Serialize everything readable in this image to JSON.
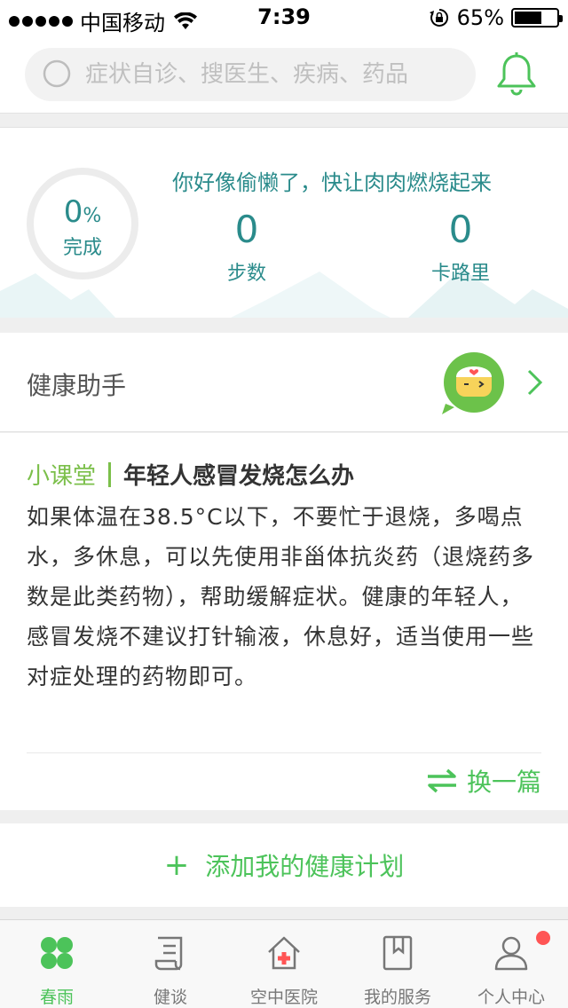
{
  "status_bar": {
    "carrier": "中国移动",
    "time": "7:39",
    "battery": "65%",
    "battery_level": 0.65
  },
  "search": {
    "placeholder": "症状自诊、搜医生、疾病、药品"
  },
  "steps_card": {
    "progress_value": "0",
    "progress_unit": "%",
    "progress_label": "完成",
    "message": "你好像偷懒了，快让肉肉燃烧起来",
    "steps_value": "0",
    "steps_label": "步数",
    "calories_value": "0",
    "calories_label": "卡路里"
  },
  "assistant": {
    "title": "健康助手"
  },
  "lesson": {
    "tag": "小课堂",
    "title": "年轻人感冒发烧怎么办",
    "body": "如果体温在38.5°C以下，不要忙于退烧，多喝点水，多休息，可以先使用非甾体抗炎药（退烧药多数是此类药物），帮助缓解症状。健康的年轻人，感冒发烧不建议打针输液，休息好，适当使用一些对症处理的药物即可。",
    "swap_label": "换一篇"
  },
  "add_plan": {
    "label": "添加我的健康计划"
  },
  "tabs": [
    {
      "label": "春雨",
      "icon": "clover-icon",
      "active": true
    },
    {
      "label": "健谈",
      "icon": "scroll-icon",
      "active": false
    },
    {
      "label": "空中医院",
      "icon": "hospital-icon",
      "active": false
    },
    {
      "label": "我的服务",
      "icon": "book-icon",
      "active": false
    },
    {
      "label": "个人中心",
      "icon": "person-icon",
      "active": false
    }
  ],
  "colors": {
    "accent_green": "#4cc35a",
    "teal": "#2a8b8b",
    "lesson_tag": "#7bbf4a",
    "notification_dot": "#f55"
  }
}
